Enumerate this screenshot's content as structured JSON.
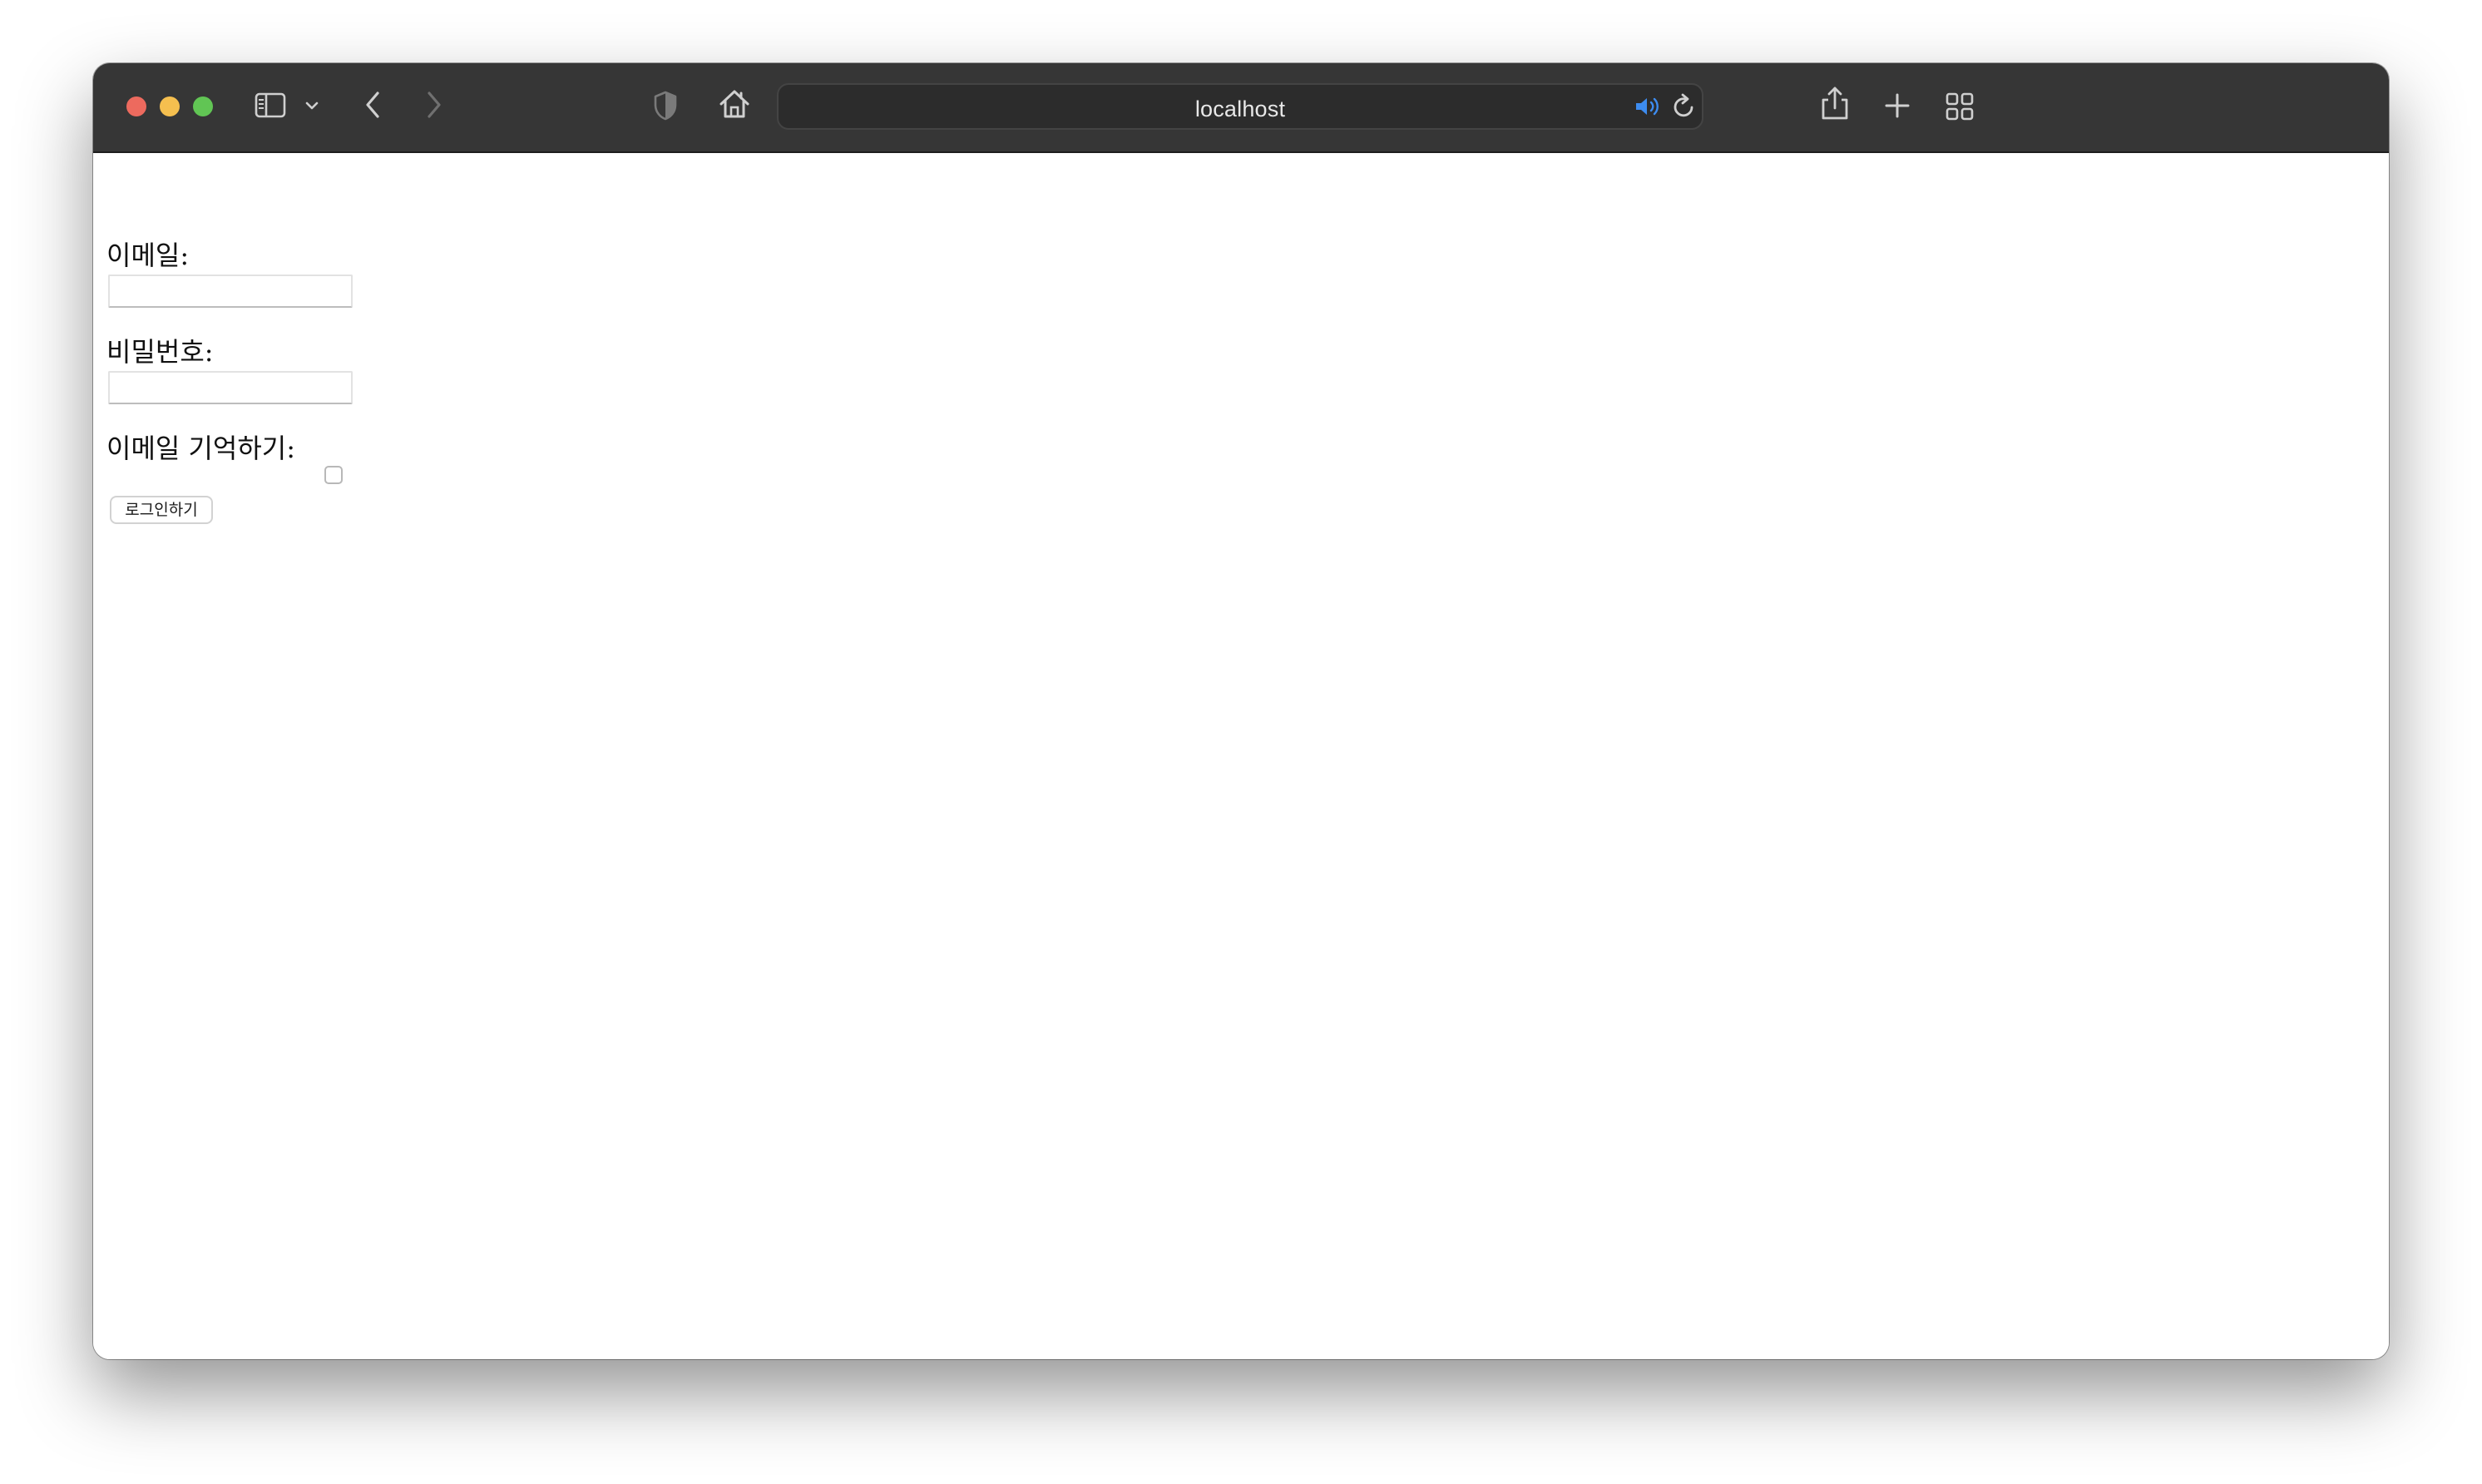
{
  "browser": {
    "address_text": "localhost",
    "icons": {
      "close": "traffic-light-close",
      "minimize": "traffic-light-minimize",
      "zoom": "traffic-light-zoom",
      "sidebar": "sidebar-icon",
      "sidebar_menu": "chevron-down-icon",
      "back": "chevron-left-icon",
      "forward": "chevron-right-icon",
      "privacy": "shield-icon",
      "home": "home-icon",
      "audio": "speaker-icon",
      "reload": "reload-icon",
      "share": "share-icon",
      "new_tab": "plus-icon",
      "tab_overview": "grid-icon"
    },
    "colors": {
      "toolbar": "#363636",
      "close": "#ed6a5e",
      "minimize": "#f5bf4f",
      "zoom": "#61c554",
      "audio_accent": "#3d8cf0"
    }
  },
  "form": {
    "email_label": "이메일:",
    "email_value": "",
    "password_label": "비밀번호:",
    "password_value": "",
    "remember_label": "이메일 기억하기:",
    "remember_checked": false,
    "submit_label": "로그인하기"
  }
}
